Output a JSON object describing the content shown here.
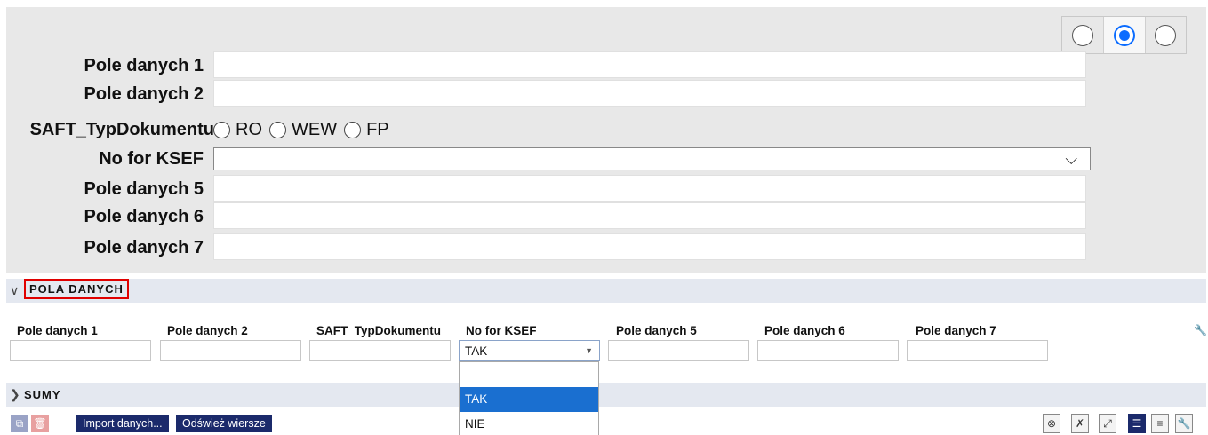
{
  "view_switch": {
    "options": [
      "",
      "",
      ""
    ],
    "selected_index": 1
  },
  "form": {
    "fields": [
      {
        "label": "Pole danych 1",
        "value": ""
      },
      {
        "label": "Pole danych 2",
        "value": ""
      },
      {
        "label": "SAFT_TypDokumentu",
        "options": [
          "RO",
          "WEW",
          "FP"
        ]
      },
      {
        "label": "No for KSEF",
        "value": ""
      },
      {
        "label": "Pole danych 5",
        "value": ""
      },
      {
        "label": "Pole danych 6",
        "value": ""
      },
      {
        "label": "Pole danych 7",
        "value": ""
      }
    ]
  },
  "sections": {
    "pola_danych": "POLA DANYCH",
    "sumy": "SUMY"
  },
  "grid": {
    "columns": [
      "Pole danych 1",
      "Pole danych 2",
      "SAFT_TypDokumentu",
      "No for KSEF",
      "Pole danych 5",
      "Pole danych 6",
      "Pole danych 7"
    ],
    "row": [
      "",
      "",
      "",
      "TAK",
      "",
      "",
      ""
    ]
  },
  "dropdown": {
    "options": [
      "",
      "TAK",
      "NIE"
    ],
    "selected": "TAK"
  },
  "toolbar": {
    "import_label": "Import danych...",
    "refresh_label": "Odśwież wiersze",
    "icons": [
      "copy-icon",
      "delete-icon",
      "cancel-icon",
      "excel-icon",
      "expand-icon",
      "list-view-icon",
      "detail-view-icon",
      "settings-icon"
    ]
  },
  "colors": {
    "accent": "#1b2a6b",
    "highlight": "#1a6fd0",
    "annotation": "#e00000"
  }
}
